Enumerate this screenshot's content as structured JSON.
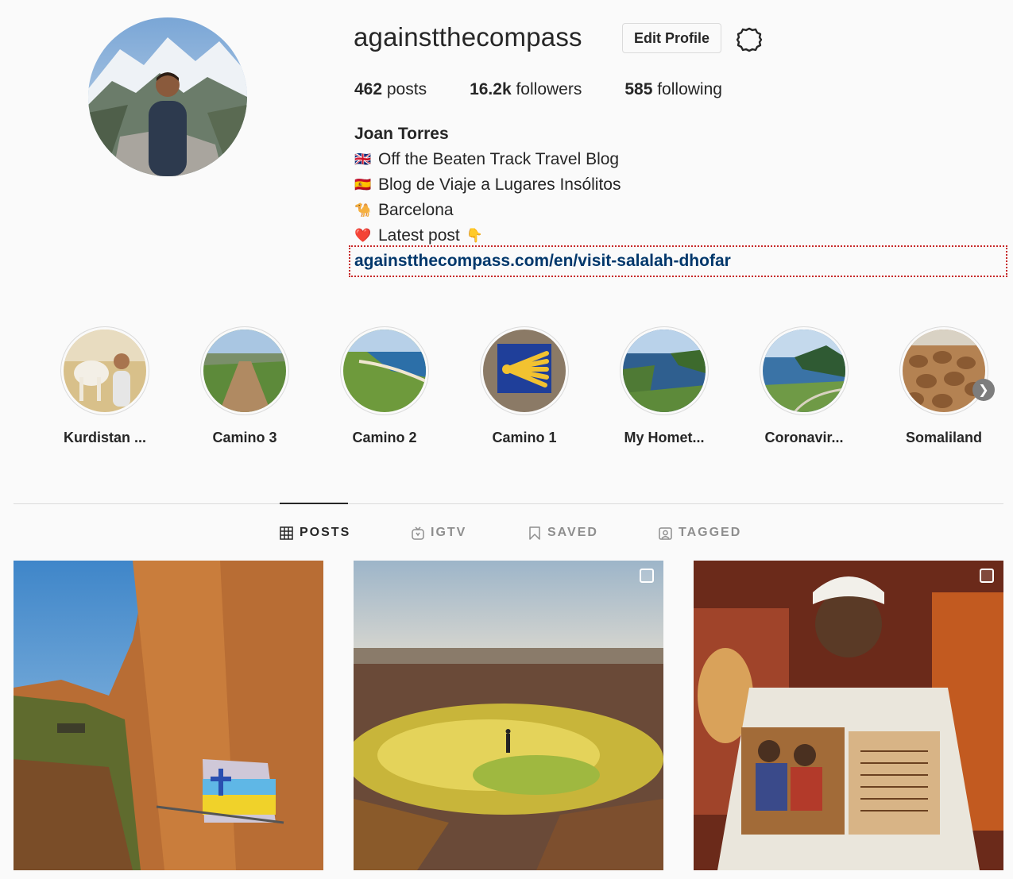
{
  "profile": {
    "username": "againstthecompass",
    "edit_profile_label": "Edit Profile",
    "posts_count": "462",
    "posts_label": " posts",
    "followers_count": "16.2k",
    "followers_label": " followers",
    "following_count": "585",
    "following_label": " following",
    "full_name": "Joan Torres",
    "bio": [
      {
        "emoji": "🇬🇧",
        "text": "Off the Beaten Track Travel Blog"
      },
      {
        "emoji": "🇪🇸",
        "text": "Blog de Viaje a Lugares Insólitos"
      },
      {
        "emoji": "🐪",
        "text": "Barcelona"
      },
      {
        "emoji": "❤️",
        "text": "Latest post",
        "trailing_emoji": "👇"
      }
    ],
    "link": "againstthecompass.com/en/visit-salalah-dhofar"
  },
  "highlights": [
    {
      "label": "Kurdistan ..."
    },
    {
      "label": "Camino 3"
    },
    {
      "label": "Camino 2"
    },
    {
      "label": "Camino 1"
    },
    {
      "label": "My Homet..."
    },
    {
      "label": "Coronavir..."
    },
    {
      "label": "Somaliland"
    }
  ],
  "tabs": [
    {
      "label": "POSTS",
      "icon": "grid-icon",
      "active": true
    },
    {
      "label": "IGTV",
      "icon": "tv-icon",
      "active": false
    },
    {
      "label": "SAVED",
      "icon": "bookmark-icon",
      "active": false
    },
    {
      "label": "TAGGED",
      "icon": "tag-icon",
      "active": false
    }
  ],
  "posts": [
    {
      "subject": "cliff church",
      "multi": false
    },
    {
      "subject": "sulfur desert",
      "multi": true
    },
    {
      "subject": "priest with manuscript",
      "multi": true
    }
  ],
  "colors": {
    "text": "#262626",
    "link": "#00376b",
    "border": "#dbdbdb",
    "muted": "#8e8e8e",
    "background": "#fafafa"
  }
}
